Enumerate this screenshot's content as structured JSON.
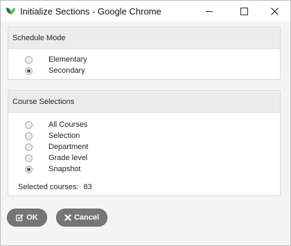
{
  "window": {
    "title": "Initialize Sections - Google Chrome"
  },
  "schedule_mode": {
    "heading": "Schedule Mode",
    "options": [
      {
        "label": "Elementary",
        "selected": false
      },
      {
        "label": "Secondary",
        "selected": true
      }
    ]
  },
  "course_selections": {
    "heading": "Course Selections",
    "options": [
      {
        "label": "All Courses",
        "selected": false
      },
      {
        "label": "Selection",
        "selected": false
      },
      {
        "label": "Department",
        "selected": false
      },
      {
        "label": "Grade level",
        "selected": false
      },
      {
        "label": "Snapshot",
        "selected": true
      }
    ],
    "selected_courses_label": "Selected courses:",
    "selected_courses_count": "83"
  },
  "buttons": {
    "ok_label": "OK",
    "cancel_label": "Cancel"
  },
  "icons": {
    "app": "chrome-app-leaf-icon",
    "ok": "checkbox-edit-icon",
    "cancel": "x-icon"
  }
}
